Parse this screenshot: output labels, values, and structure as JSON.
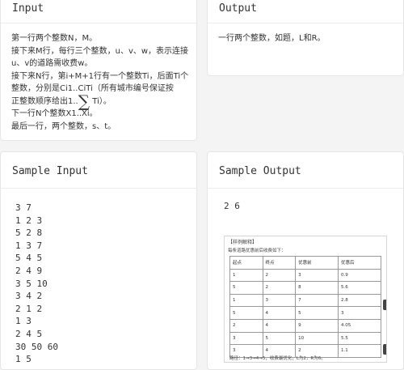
{
  "input": {
    "title": "Input",
    "lines": [
      "第一行两个整数N，M。",
      "接下来M行，每行三个整数，u、v、w，表示连接",
      "u、v的道路需收费w。",
      "接下来N行，第i+M+1行有一个整数Ti，后面Ti个",
      "整数，分别是Ci1..CiTi（所有城市编号保证按",
      "正整数顺序给出1..",
      "Ti）。",
      "下一行N个整数X1..Xi。",
      "最后一行，两个整数，s、t。"
    ],
    "sigma": "∑"
  },
  "output": {
    "title": "Output",
    "text": "一行两个整数，如题，L和R。"
  },
  "sample_input": {
    "title": "Sample Input",
    "lines": [
      "3 7",
      "1 2 3",
      "5 2 8",
      "1 3 7",
      "5 4 5",
      "2 4 9",
      "3 5 10",
      "3 4 2",
      "2 1 2",
      "1 3",
      "2 4 5",
      "30 50 60",
      "1 5"
    ]
  },
  "sample_output": {
    "title": "Sample Output",
    "text": "2 6",
    "figure": {
      "header": "【样例解释】",
      "subheader": "每条道路优惠前后收费如下：",
      "columns": [
        "起点",
        "终点",
        "优惠前",
        "优惠后"
      ],
      "rows": [
        [
          "1",
          "2",
          "3",
          "0.9"
        ],
        [
          "5",
          "2",
          "8",
          "5.6"
        ],
        [
          "1",
          "3",
          "7",
          "2.8"
        ],
        [
          "5",
          "4",
          "5",
          "3"
        ],
        [
          "2",
          "4",
          "9",
          "4.05"
        ],
        [
          "3",
          "5",
          "10",
          "5.5"
        ],
        [
          "3",
          "4",
          "2",
          "1.1"
        ]
      ],
      "footer": "路径：1→3→4→5，收费最优化，L为2，R为6。"
    }
  }
}
